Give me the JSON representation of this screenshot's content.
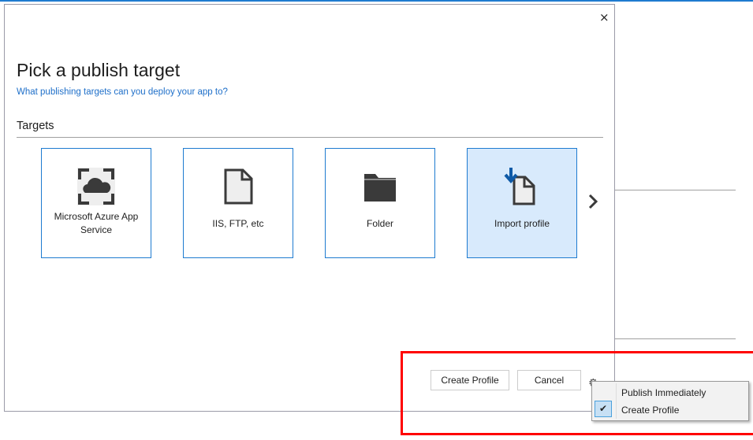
{
  "dialog": {
    "close_label": "×",
    "title": "Pick a publish target",
    "subtitle": "What publishing targets can you deploy your app to?",
    "section": "Targets",
    "targets": [
      {
        "label": "Microsoft Azure App Service",
        "icon": "azure-cloud-icon"
      },
      {
        "label": "IIS, FTP, etc",
        "icon": "file-icon"
      },
      {
        "label": "Folder",
        "icon": "folder-icon"
      },
      {
        "label": "Import profile",
        "icon": "import-profile-icon",
        "selected": true
      }
    ],
    "create_profile_button": "Create Profile",
    "cancel_button": "Cancel",
    "menu": {
      "items": [
        {
          "label": "Publish Immediately",
          "checked": false
        },
        {
          "label": "Create Profile",
          "checked": true
        }
      ],
      "check_glyph": "✔"
    }
  },
  "colors": {
    "accent": "#1e7bd0",
    "selected_bg": "#d8eafc",
    "highlight": "#ff0000"
  }
}
